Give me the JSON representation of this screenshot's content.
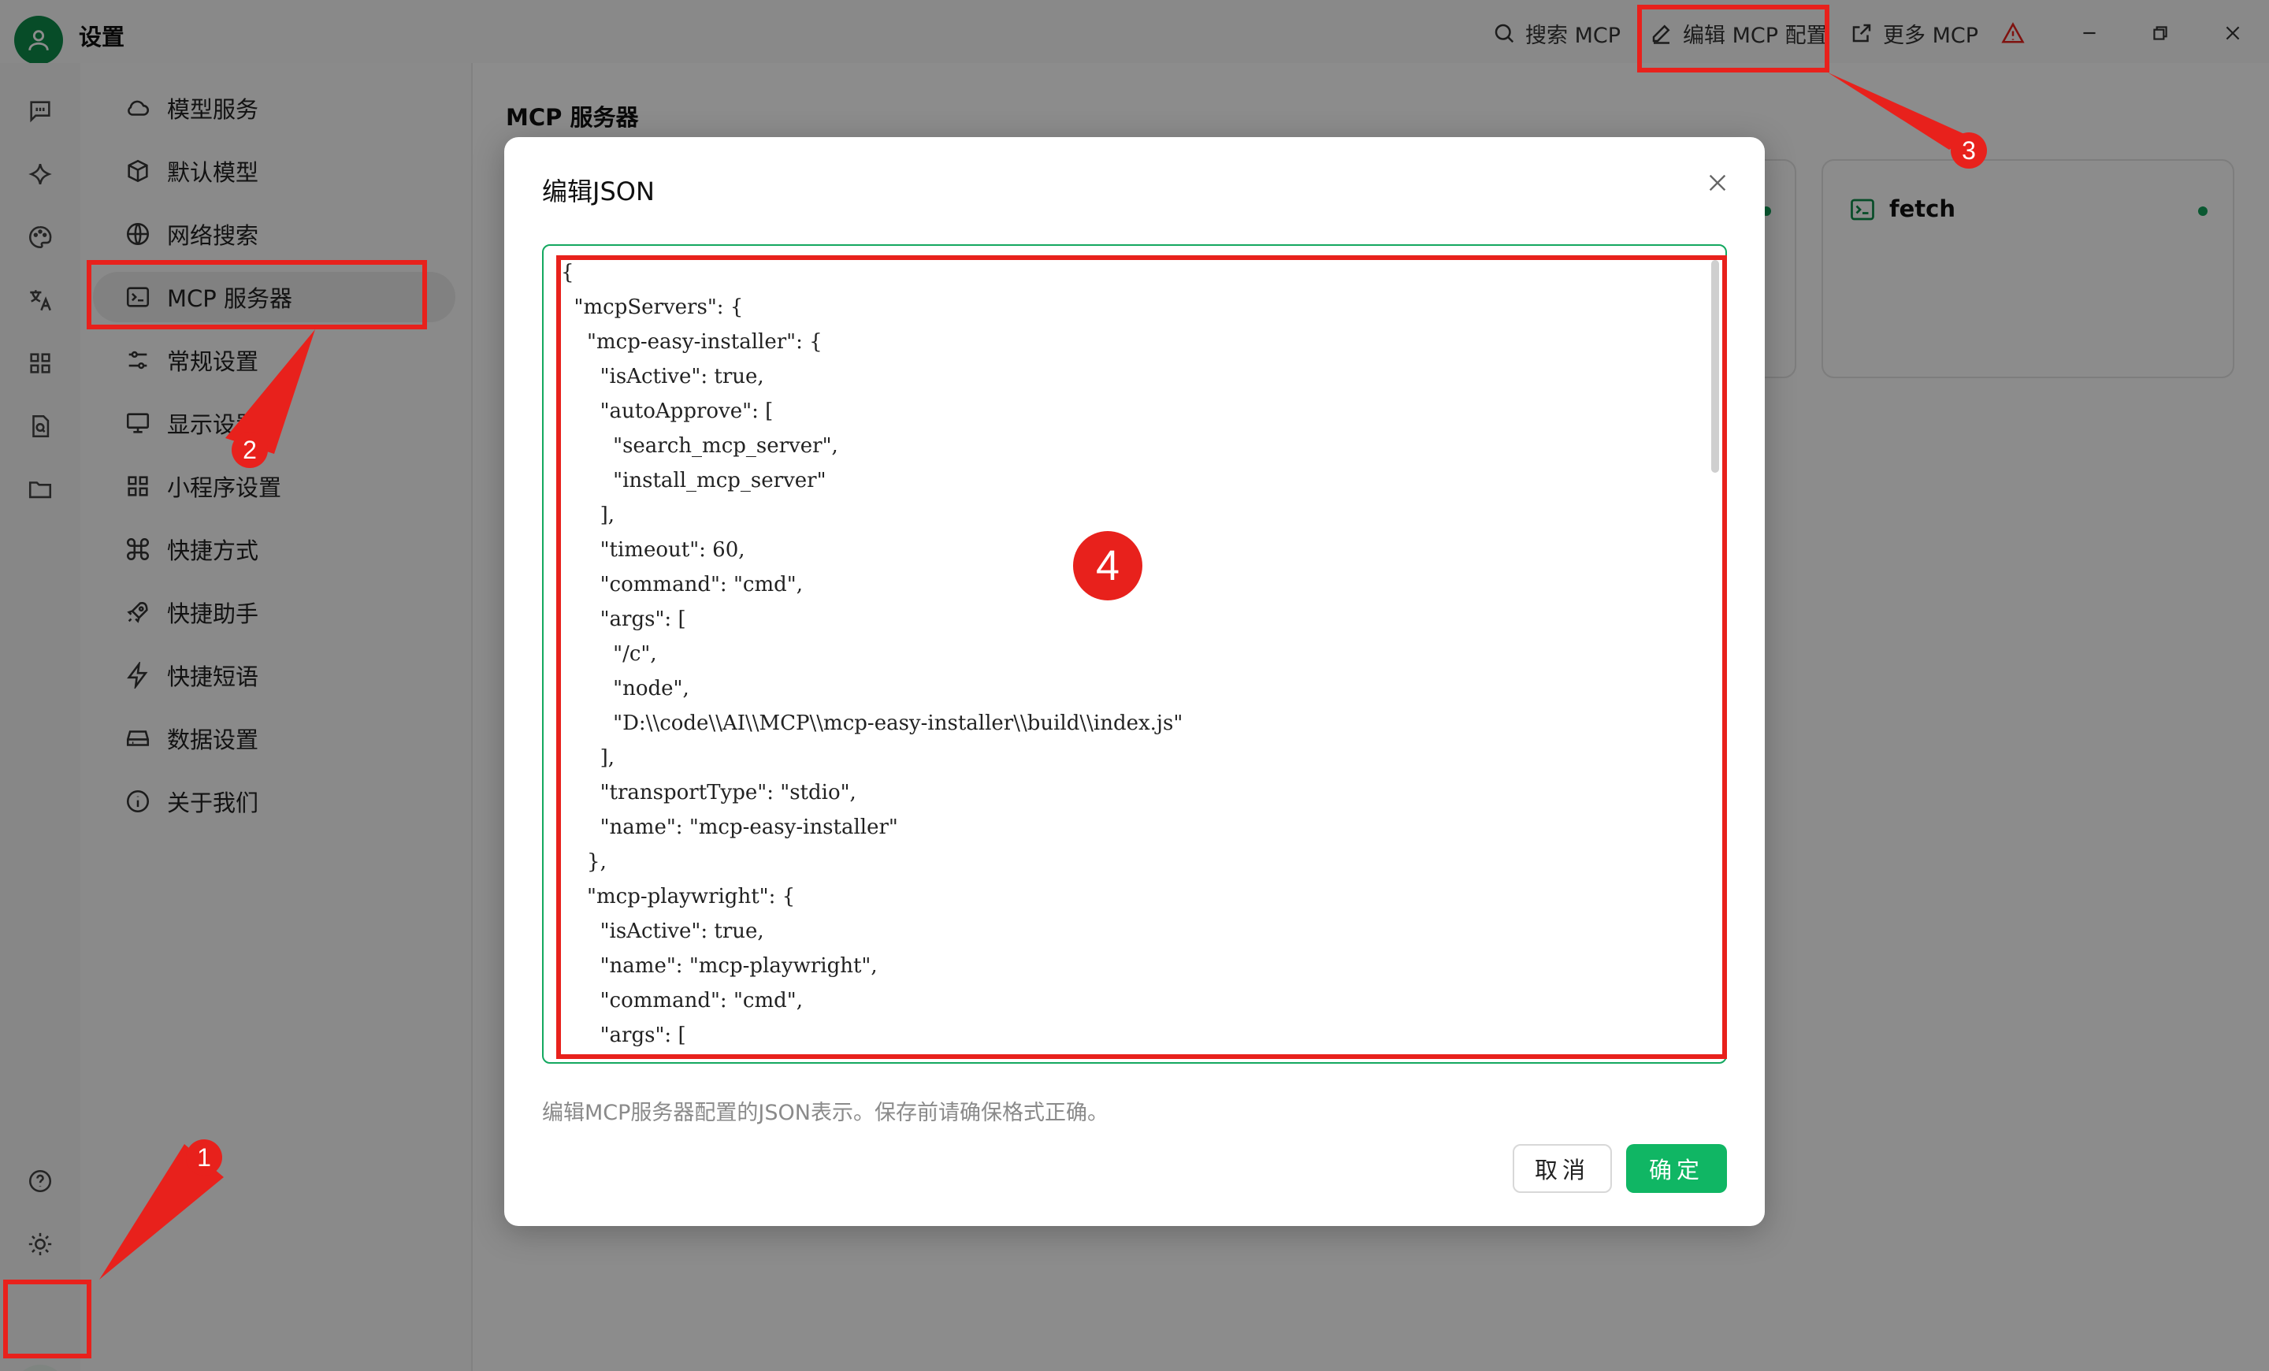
{
  "app": {
    "title": "设置"
  },
  "toolbar": {
    "search_mcp": "搜索 MCP",
    "edit_mcp_config": "编辑 MCP 配置",
    "more_mcp": "更多 MCP"
  },
  "settings_nav": {
    "items": [
      {
        "label": "模型服务",
        "icon": "cloud-icon"
      },
      {
        "label": "默认模型",
        "icon": "cube-icon"
      },
      {
        "label": "网络搜索",
        "icon": "globe-icon"
      },
      {
        "label": "MCP 服务器",
        "icon": "terminal-icon",
        "active": true
      },
      {
        "label": "常规设置",
        "icon": "sliders-icon"
      },
      {
        "label": "显示设置",
        "icon": "monitor-icon"
      },
      {
        "label": "小程序设置",
        "icon": "grid-icon"
      },
      {
        "label": "快捷方式",
        "icon": "command-icon"
      },
      {
        "label": "快捷助手",
        "icon": "rocket-icon"
      },
      {
        "label": "快捷短语",
        "icon": "bolt-icon"
      },
      {
        "label": "数据设置",
        "icon": "drive-icon"
      },
      {
        "label": "关于我们",
        "icon": "info-icon"
      }
    ]
  },
  "main": {
    "title": "MCP 服务器",
    "cards": [
      {
        "name": "fetch",
        "status_color": "#13a05a"
      }
    ]
  },
  "modal": {
    "title": "编辑JSON",
    "code_lines": [
      "{",
      "  \"mcpServers\": {",
      "    \"mcp-easy-installer\": {",
      "      \"isActive\": true,",
      "      \"autoApprove\": [",
      "        \"search_mcp_server\",",
      "        \"install_mcp_server\"",
      "      ],",
      "      \"timeout\": 60,",
      "      \"command\": \"cmd\",",
      "      \"args\": [",
      "        \"/c\",",
      "        \"node\",",
      "        \"D:\\\\code\\\\AI\\\\MCP\\\\mcp-easy-installer\\\\build\\\\index.js\"",
      "      ],",
      "      \"transportType\": \"stdio\",",
      "      \"name\": \"mcp-easy-installer\"",
      "    },",
      "    \"mcp-playwright\": {",
      "      \"isActive\": true,",
      "      \"name\": \"mcp-playwright\",",
      "      \"command\": \"cmd\",",
      "      \"args\": ["
    ],
    "hint": "编辑MCP服务器配置的JSON表示。保存前请确保格式正确。",
    "cancel_label": "取消",
    "ok_label": "确定"
  },
  "annotations": {
    "badge_1": "1",
    "badge_2": "2",
    "badge_3": "3",
    "badge_4": "4",
    "color": "#e8211c"
  },
  "colors": {
    "accent": "#10b664",
    "avatar": "#0d8a4a",
    "warning": "#e8211c"
  }
}
